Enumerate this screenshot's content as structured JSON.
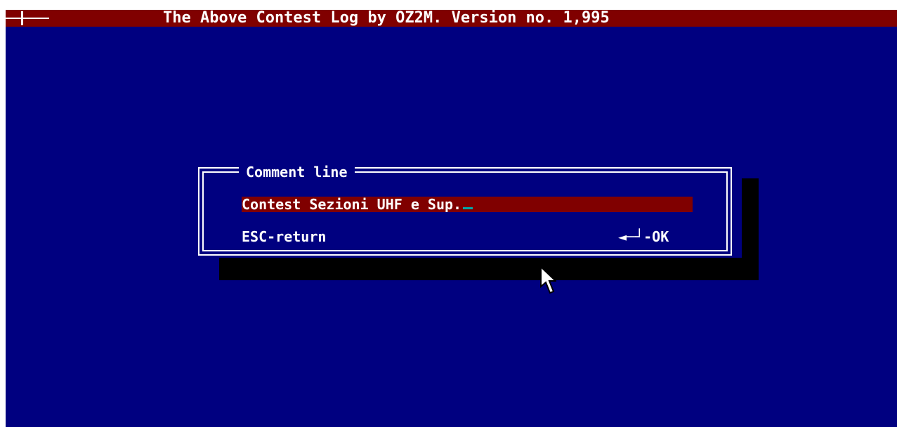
{
  "window": {
    "title": "The Above Contest Log by OZ2M. Version no. 1,995",
    "system_menu_icon": "system-menu-icon"
  },
  "dialog": {
    "title": "Comment line",
    "input_value": "Contest Sezioni UHF e Sup.",
    "escape_hint": "ESC-return",
    "ok_hint": "◄─┘-OK"
  },
  "colors": {
    "desktop": "#000080",
    "title_bar": "#800000",
    "input_background": "#800000",
    "text": "#ffffff",
    "shadow": "#000000",
    "cursor": "#00a8a8"
  },
  "icons": {
    "pointer": "mouse-pointer-icon",
    "system_menu": "system-menu-icon"
  }
}
